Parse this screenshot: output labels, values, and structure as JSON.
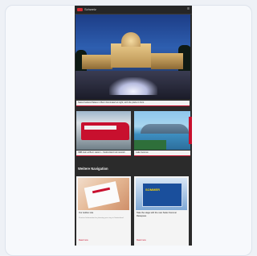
{
  "topbar": {
    "brand": "Schweiz",
    "menu_glyph": "≡"
  },
  "hero": {
    "caption": "Swiss Federal Palace in Bern illuminated at night, with the plaza in front"
  },
  "cards": [
    {
      "caption": "SBB train at Bern station – Switzerland rail network"
    },
    {
      "caption": "Lake Geneva"
    }
  ],
  "section_title": "Weitere Navigation",
  "tiles": [
    {
      "title": "Our toolbox site",
      "sub": "Practical information for planning your stay in Switzerland",
      "more": "Read more",
      "image_text": ""
    },
    {
      "title": "Take the stage with the new Swiss Sommer Reisepass",
      "sub": "",
      "more": "Read more",
      "image_text": "SOMMER"
    }
  ],
  "colors": {
    "accent": "#c8102e",
    "page_bg": "#2b2b2b"
  }
}
